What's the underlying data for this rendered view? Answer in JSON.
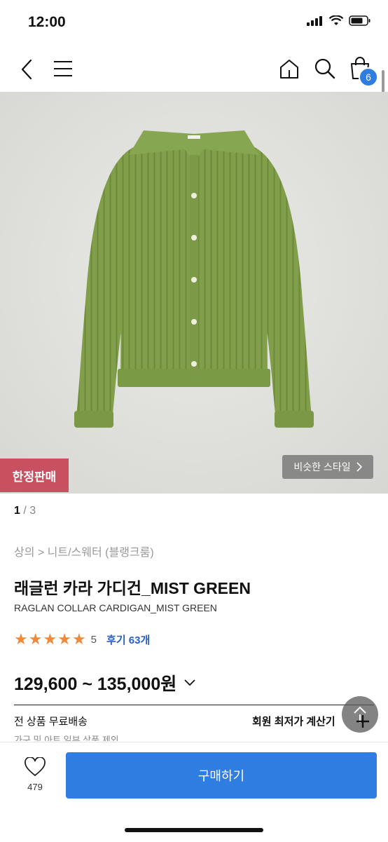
{
  "status": {
    "time": "12:00"
  },
  "nav": {
    "cart_count": "6"
  },
  "hero": {
    "limited_label": "한정판매",
    "similar_label": "비슷한 스타일"
  },
  "pager": {
    "current": "1",
    "total": " / 3"
  },
  "breadcrumb": "상의 > 니트/스웨터 (블랭크룸)",
  "product": {
    "title": "래글런 카라 가디건_MIST GREEN",
    "subtitle": "RAGLAN COLLAR CARDIGAN_MIST GREEN",
    "rating": "5",
    "reviews": "후기 63개",
    "price": "129,600 ~ 135,000원"
  },
  "info": {
    "shipping": "전 상품 무료배송",
    "shipping_note": "가구 및 아트 일부 상품 제외",
    "member_calc": "회원 최저가 계산기"
  },
  "bottom": {
    "like_count": "479",
    "buy_label": "구매하기"
  },
  "colors": {
    "accent": "#2f7de1",
    "limited": "#c8505f",
    "star": "#f08a3a",
    "review_link": "#2b5fc7",
    "cardigan": "#7f9e49"
  },
  "icons": [
    "back-icon",
    "menu-icon",
    "home-icon",
    "search-icon",
    "cart-icon",
    "chevron-right-icon",
    "chevron-down-icon",
    "scroll-top-icon",
    "heart-icon"
  ]
}
